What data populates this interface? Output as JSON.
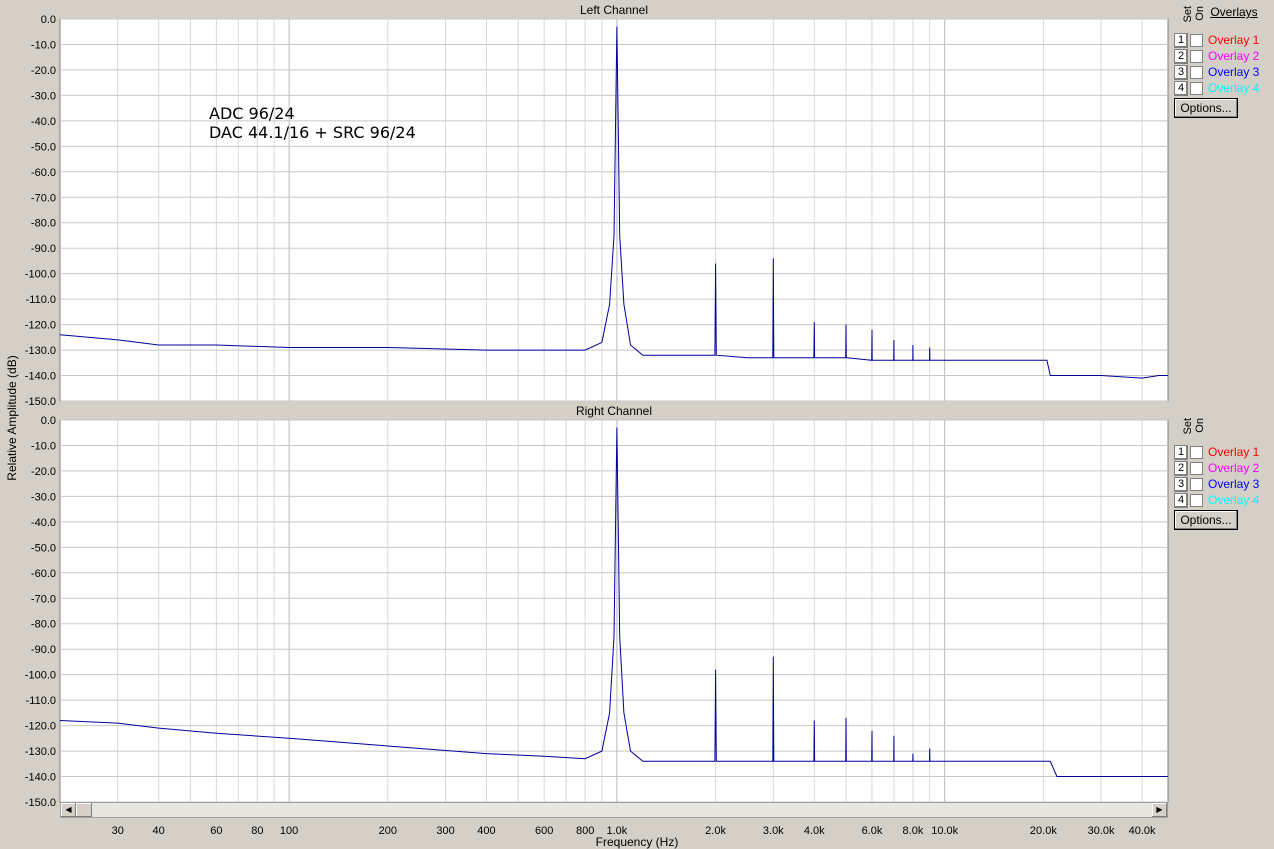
{
  "window": {
    "ylabel": "Relative Amplitude (dB)",
    "xlabel": "Frequency (Hz)"
  },
  "annotation": {
    "line1": "ADC 96/24",
    "line2": "DAC 44.1/16 + SRC 96/24"
  },
  "overlays": {
    "title": "Overlays",
    "set_label": "Set",
    "on_label": "On",
    "options_label": "Options...",
    "items": [
      {
        "num": "1",
        "label": "Overlay 1",
        "color": "#ff0000"
      },
      {
        "num": "2",
        "label": "Overlay 2",
        "color": "#ff00ff"
      },
      {
        "num": "3",
        "label": "Overlay 3",
        "color": "#0000ff"
      },
      {
        "num": "4",
        "label": "Overlay 4",
        "color": "#00ffff"
      }
    ]
  },
  "colors": {
    "trace": "#00009c",
    "plot_bg": "#ffffff",
    "grid": "#c8c8c8"
  },
  "chart_data": [
    {
      "type": "line",
      "title": "Left Channel",
      "xscale": "log",
      "xlim": [
        20,
        48000
      ],
      "ylim": [
        -150,
        0
      ],
      "yticks": [
        0,
        -10,
        -20,
        -30,
        -40,
        -50,
        -60,
        -70,
        -80,
        -90,
        -100,
        -110,
        -120,
        -130,
        -140,
        -150
      ],
      "ytick_labels": [
        "0.0",
        "-10.0",
        "-20.0",
        "-30.0",
        "-40.0",
        "-50.0",
        "-60.0",
        "-70.0",
        "-80.0",
        "-90.0",
        "-100.0",
        "-110.0",
        "-120.0",
        "-130.0",
        "-140.0",
        "-150.0"
      ],
      "xticks": [
        30,
        40,
        60,
        80,
        100,
        200,
        300,
        400,
        600,
        800,
        1000,
        2000,
        3000,
        4000,
        6000,
        8000,
        10000,
        20000,
        30000,
        40000
      ],
      "xtick_labels": [
        "30",
        "40",
        "60",
        "80",
        "100",
        "200",
        "300",
        "400",
        "600",
        "800",
        "1.0k",
        "2.0k",
        "3.0k",
        "4.0k",
        "6.0k",
        "8.0k",
        "10.0k",
        "20.0k",
        "30.0k",
        "40.0k"
      ],
      "series": [
        {
          "x": [
            20,
            30,
            40,
            60,
            100,
            200,
            400,
            600,
            800,
            900,
            950,
            980,
            1000,
            1020,
            1050,
            1100,
            1200,
            1500,
            1990,
            2000,
            2010,
            2500,
            2990,
            3000,
            3010,
            3990,
            4000,
            4010,
            4990,
            5000,
            5010,
            5990,
            6000,
            6010,
            6990,
            7000,
            7010,
            7990,
            8000,
            8010,
            8990,
            9000,
            9010,
            10000,
            15000,
            20000,
            20500,
            21000,
            30000,
            40000,
            45000,
            48000
          ],
          "y": [
            -124,
            -126,
            -128,
            -128,
            -129,
            -129,
            -130,
            -130,
            -130,
            -127,
            -112,
            -85,
            -3,
            -85,
            -112,
            -128,
            -132,
            -132,
            -132,
            -96,
            -132,
            -133,
            -133,
            -94,
            -133,
            -133,
            -119,
            -133,
            -133,
            -120,
            -133,
            -134,
            -122,
            -134,
            -134,
            -126,
            -134,
            -134,
            -128,
            -134,
            -134,
            -129,
            -134,
            -134,
            -134,
            -134,
            -134,
            -140,
            -140,
            -141,
            -140,
            -140
          ]
        }
      ]
    },
    {
      "type": "line",
      "title": "Right Channel",
      "xscale": "log",
      "xlim": [
        20,
        48000
      ],
      "ylim": [
        -150,
        0
      ],
      "yticks": [
        0,
        -10,
        -20,
        -30,
        -40,
        -50,
        -60,
        -70,
        -80,
        -90,
        -100,
        -110,
        -120,
        -130,
        -140,
        -150
      ],
      "ytick_labels": [
        "0.0",
        "-10.0",
        "-20.0",
        "-30.0",
        "-40.0",
        "-50.0",
        "-60.0",
        "-70.0",
        "-80.0",
        "-90.0",
        "-100.0",
        "-110.0",
        "-120.0",
        "-130.0",
        "-140.0",
        "-150.0"
      ],
      "xticks": [
        30,
        40,
        60,
        80,
        100,
        200,
        300,
        400,
        600,
        800,
        1000,
        2000,
        3000,
        4000,
        6000,
        8000,
        10000,
        20000,
        30000,
        40000
      ],
      "xtick_labels": [
        "30",
        "40",
        "60",
        "80",
        "100",
        "200",
        "300",
        "400",
        "600",
        "800",
        "1.0k",
        "2.0k",
        "3.0k",
        "4.0k",
        "6.0k",
        "8.0k",
        "10.0k",
        "20.0k",
        "30.0k",
        "40.0k"
      ],
      "series": [
        {
          "x": [
            20,
            30,
            40,
            60,
            100,
            200,
            400,
            600,
            800,
            900,
            950,
            980,
            1000,
            1020,
            1050,
            1100,
            1200,
            1500,
            1990,
            2000,
            2010,
            2500,
            2990,
            3000,
            3010,
            3990,
            4000,
            4010,
            4990,
            5000,
            5010,
            5990,
            6000,
            6010,
            6990,
            7000,
            7010,
            7990,
            8000,
            8010,
            8990,
            9000,
            9010,
            10000,
            15000,
            20000,
            21000,
            22000,
            30000,
            40000,
            45000,
            48000
          ],
          "y": [
            -118,
            -119,
            -121,
            -123,
            -125,
            -128,
            -131,
            -132,
            -133,
            -130,
            -115,
            -85,
            -3,
            -85,
            -115,
            -130,
            -134,
            -134,
            -134,
            -98,
            -134,
            -134,
            -134,
            -93,
            -134,
            -134,
            -118,
            -134,
            -134,
            -117,
            -134,
            -134,
            -122,
            -134,
            -134,
            -124,
            -134,
            -134,
            -131,
            -134,
            -134,
            -129,
            -134,
            -134,
            -134,
            -134,
            -134,
            -140,
            -140,
            -140,
            -140,
            -140
          ]
        }
      ]
    }
  ]
}
